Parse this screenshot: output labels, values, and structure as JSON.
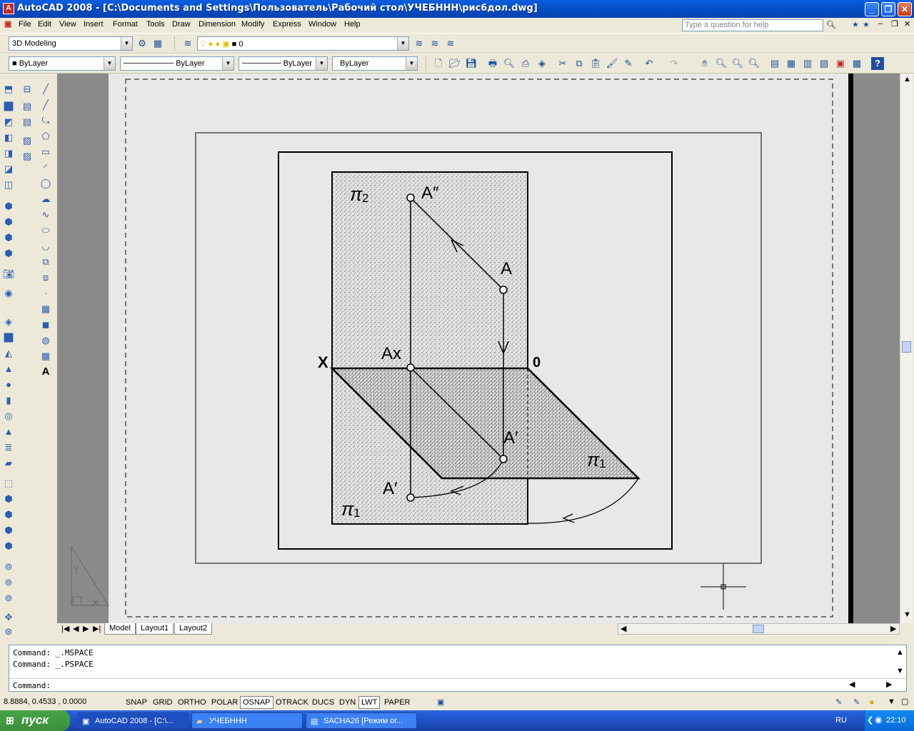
{
  "window": {
    "title": "AutoCAD 2008 - [C:\\Documents and Settings\\Пользователь\\Рабочий стол\\УЧЕБННН\\рис6дол.dwg]",
    "minimize": "_",
    "restore": "❐",
    "close": "✕"
  },
  "menu": {
    "items": [
      "File",
      "Edit",
      "View",
      "Insert",
      "Format",
      "Tools",
      "Draw",
      "Dimension",
      "Modify",
      "Express",
      "Window",
      "Help"
    ],
    "help_placeholder": "Type a question for help"
  },
  "toolbar": {
    "workspace": "3D Modeling",
    "layer": "0",
    "color": "ByLayer",
    "linetype": "ByLayer",
    "lineweight": "ByLayer",
    "plotstyle": "ByLayer"
  },
  "drawing": {
    "pi2_label": "π",
    "pi2_sub": "2",
    "a_double_prime": "A″",
    "a_label": "A",
    "ax_label": "Ax",
    "x_label": "X",
    "zero_label": "0",
    "a_prime_label": "A′",
    "pi1_label": "π",
    "pi1_sub": "1"
  },
  "tabs": {
    "model": "Model",
    "layout1": "Layout1",
    "layout2": "Layout2"
  },
  "command": {
    "lines": [
      "Command: _.MSPACE",
      "Command: _.PSPACE"
    ],
    "prompt": "Command:"
  },
  "status": {
    "coords": "8.8884,  0.4533 , 0.0000",
    "buttons": [
      "SNAP",
      "GRID",
      "ORTHO",
      "POLAR",
      "OSNAP",
      "OTRACK",
      "DUCS",
      "DYN",
      "LWT",
      "PAPER"
    ]
  },
  "taskbar": {
    "start": "пуск",
    "tasks": [
      "AutoCAD 2008 - [C:\\...",
      "УЧЕБННН",
      "SACHA26 [Режим ог..."
    ],
    "lang": "RU",
    "time": "22:10"
  }
}
